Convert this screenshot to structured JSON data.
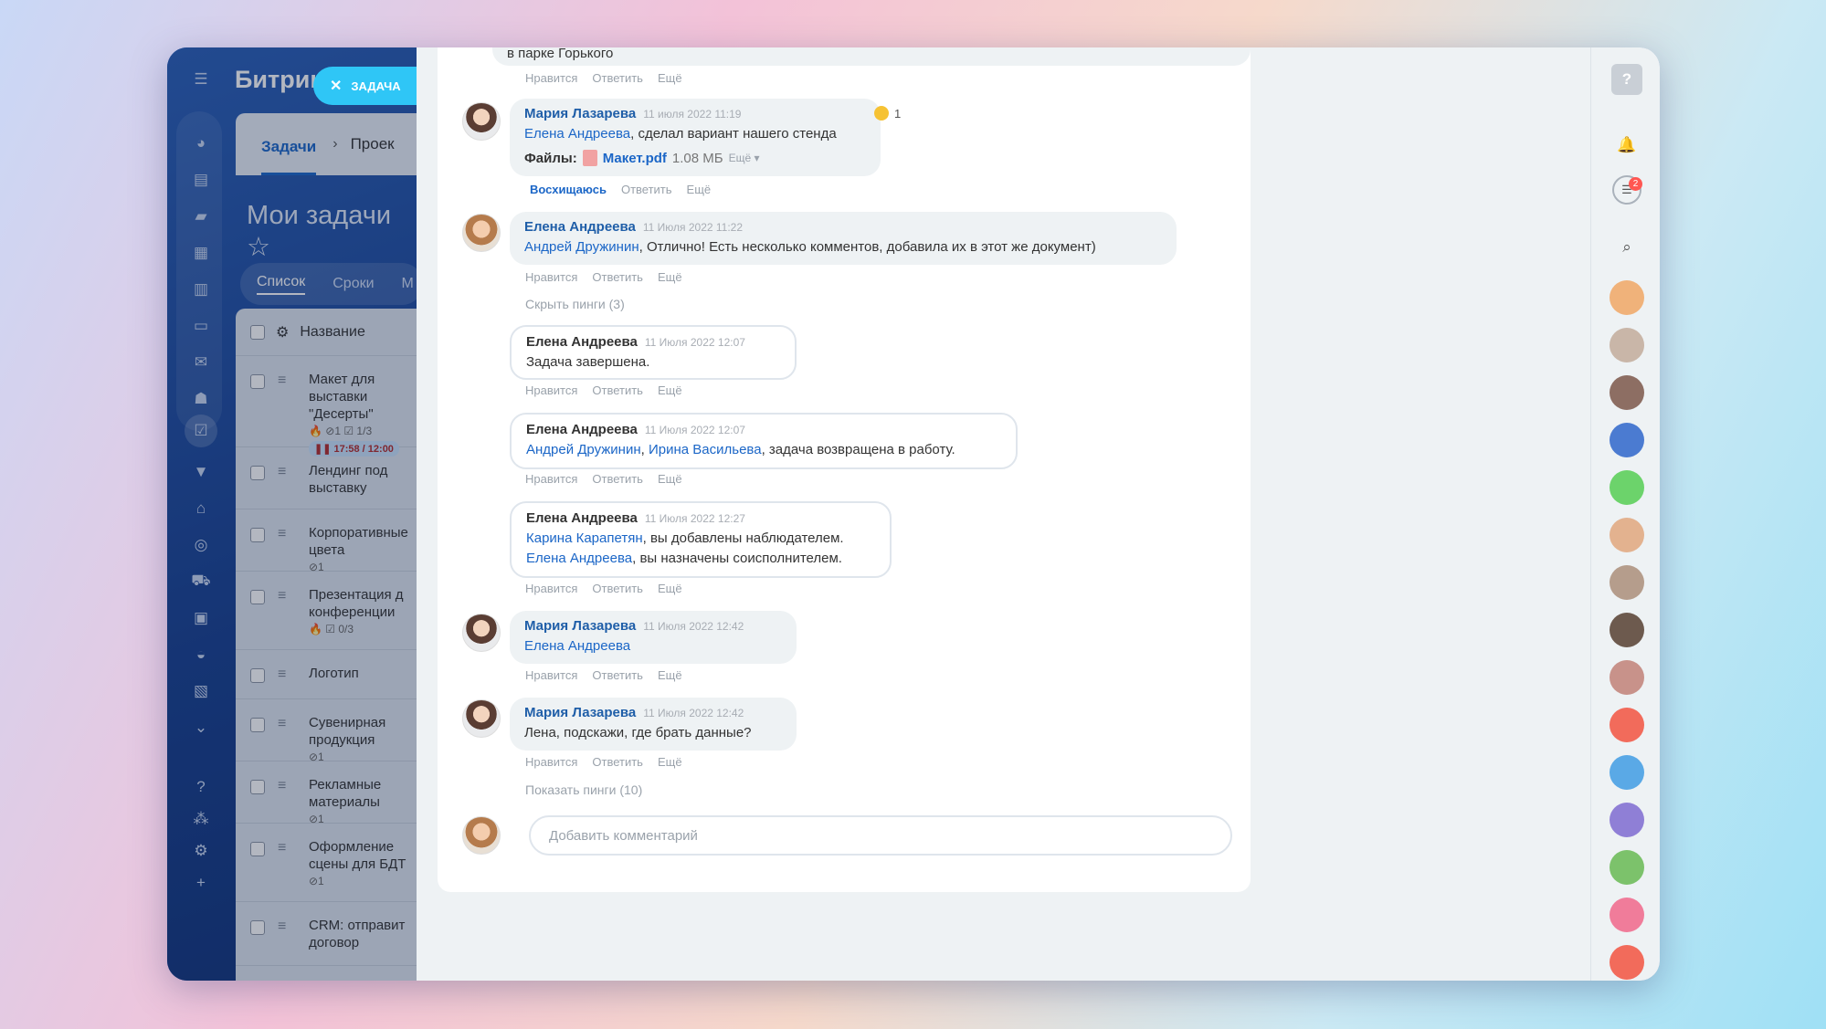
{
  "app": {
    "brand": "Битрикс",
    "task_pill": "ЗАДАЧА",
    "tab_tasks": "Задачи",
    "tab_projects": "Проек",
    "page_title": "Мои задачи",
    "view_list": "Список",
    "view_deadlines": "Сроки",
    "view_more": "М",
    "column_name": "Название"
  },
  "tasks": [
    {
      "name": "Макет для\nвыставки\n\"Десерты\"",
      "meta": "🔥 ⊘1  ☑ 1/3",
      "timer": "❚❚ 17:58 / 12:00"
    },
    {
      "name": "Лендинг под\nвыставку",
      "meta": ""
    },
    {
      "name": "Корпоративные\nцвета",
      "meta": "⊘1"
    },
    {
      "name": "Презентация д\nконференции",
      "meta": "🔥 ☑ 0/3"
    },
    {
      "name": "Логотип",
      "meta": ""
    },
    {
      "name": "Сувенирная\nпродукция",
      "meta": "⊘1"
    },
    {
      "name": "Рекламные\nматериалы",
      "meta": "⊘1"
    },
    {
      "name": "Оформление\nсцены для БДТ",
      "meta": "⊘1"
    },
    {
      "name": "CRM: отправит\nдоговор",
      "meta": ""
    }
  ],
  "actions": {
    "like": "Нравится",
    "reply": "Ответить",
    "more": "Ещё",
    "admire": "Восхищаюсь"
  },
  "comments": {
    "c0_text": "в парке Горького",
    "c1_author": "Мария Лазарева",
    "c1_date": "11 июля 2022 11:19",
    "c1_link": "Елена Андреева",
    "c1_text": ", сделал вариант нашего стенда",
    "c1_files_label": "Файлы:",
    "c1_file": "Макет.pdf",
    "c1_size": "1.08 МБ",
    "c1_file_more": "Ещё ▾",
    "c1_reaction_count": "1",
    "c2_author": "Елена Андреева",
    "c2_date": "11 Июля 2022 11:22",
    "c2_link": "Андрей Дружинин",
    "c2_text": ", Отлично! Есть несколько комментов, добавила их в этот же документ)",
    "hide_pings": "Скрыть пинги (3)",
    "p1_author": "Елена Андреева",
    "p1_date": "11 Июля 2022 12:07",
    "p1_text": "Задача завершена.",
    "p2_author": "Елена Андреева",
    "p2_date": "11 Июля 2022 12:07",
    "p2_link1": "Андрей Дружинин",
    "p2_sep": ", ",
    "p2_link2": "Ирина Васильева",
    "p2_text": ", задача возвращена в работу.",
    "p3_author": "Елена Андреева",
    "p3_date": "11 Июля 2022 12:27",
    "p3_link1": "Карина Карапетян",
    "p3_text1": ", вы добавлены наблюдателем.",
    "p3_link2": "Елена Андреева",
    "p3_text2": ", вы назначены соисполнителем.",
    "c3_author": "Мария Лазарева",
    "c3_date": "11 Июля 2022 12:42",
    "c3_link": "Елена Андреева",
    "c4_author": "Мария Лазарева",
    "c4_date": "11 Июля 2022 12:42",
    "c4_text": "Лена, подскажи, где брать данные?",
    "show_pings": "Показать пинги (10)",
    "placeholder": "Добавить комментарий"
  },
  "rightbar": {
    "help": "?",
    "chat_badge": "2"
  },
  "colors": {
    "accent": "#1b66c7",
    "pill": "#2fc6f6",
    "sidebar": "#1d4ba0"
  }
}
